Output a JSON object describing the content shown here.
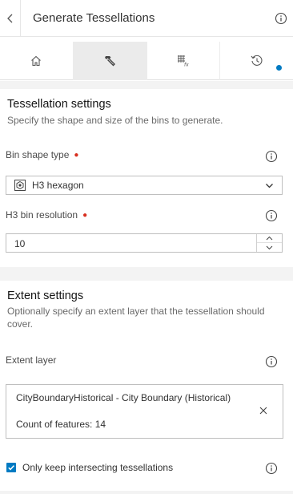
{
  "header": {
    "title": "Generate Tessellations"
  },
  "tabs": [
    {
      "icon": "home-icon"
    },
    {
      "icon": "hammer-icon"
    },
    {
      "icon": "grid-function-icon"
    },
    {
      "icon": "history-icon"
    }
  ],
  "tessellation": {
    "title": "Tessellation settings",
    "description": "Specify the shape and size of the bins to generate.",
    "bin_shape_label": "Bin shape type",
    "bin_shape_value": "H3 hexagon",
    "resolution_label": "H3 bin resolution",
    "resolution_value": "10"
  },
  "extent": {
    "title": "Extent settings",
    "description": "Optionally specify an extent layer that the tessellation should cover.",
    "layer_label": "Extent layer",
    "layer_name": "CityBoundaryHistorical - City Boundary (Historical)",
    "layer_count": "Count of features: 14",
    "intersect_label": "Only keep intersecting tessellations",
    "intersect_checked": true
  },
  "colors": {
    "accent": "#007ac2",
    "required": "#d83020"
  }
}
